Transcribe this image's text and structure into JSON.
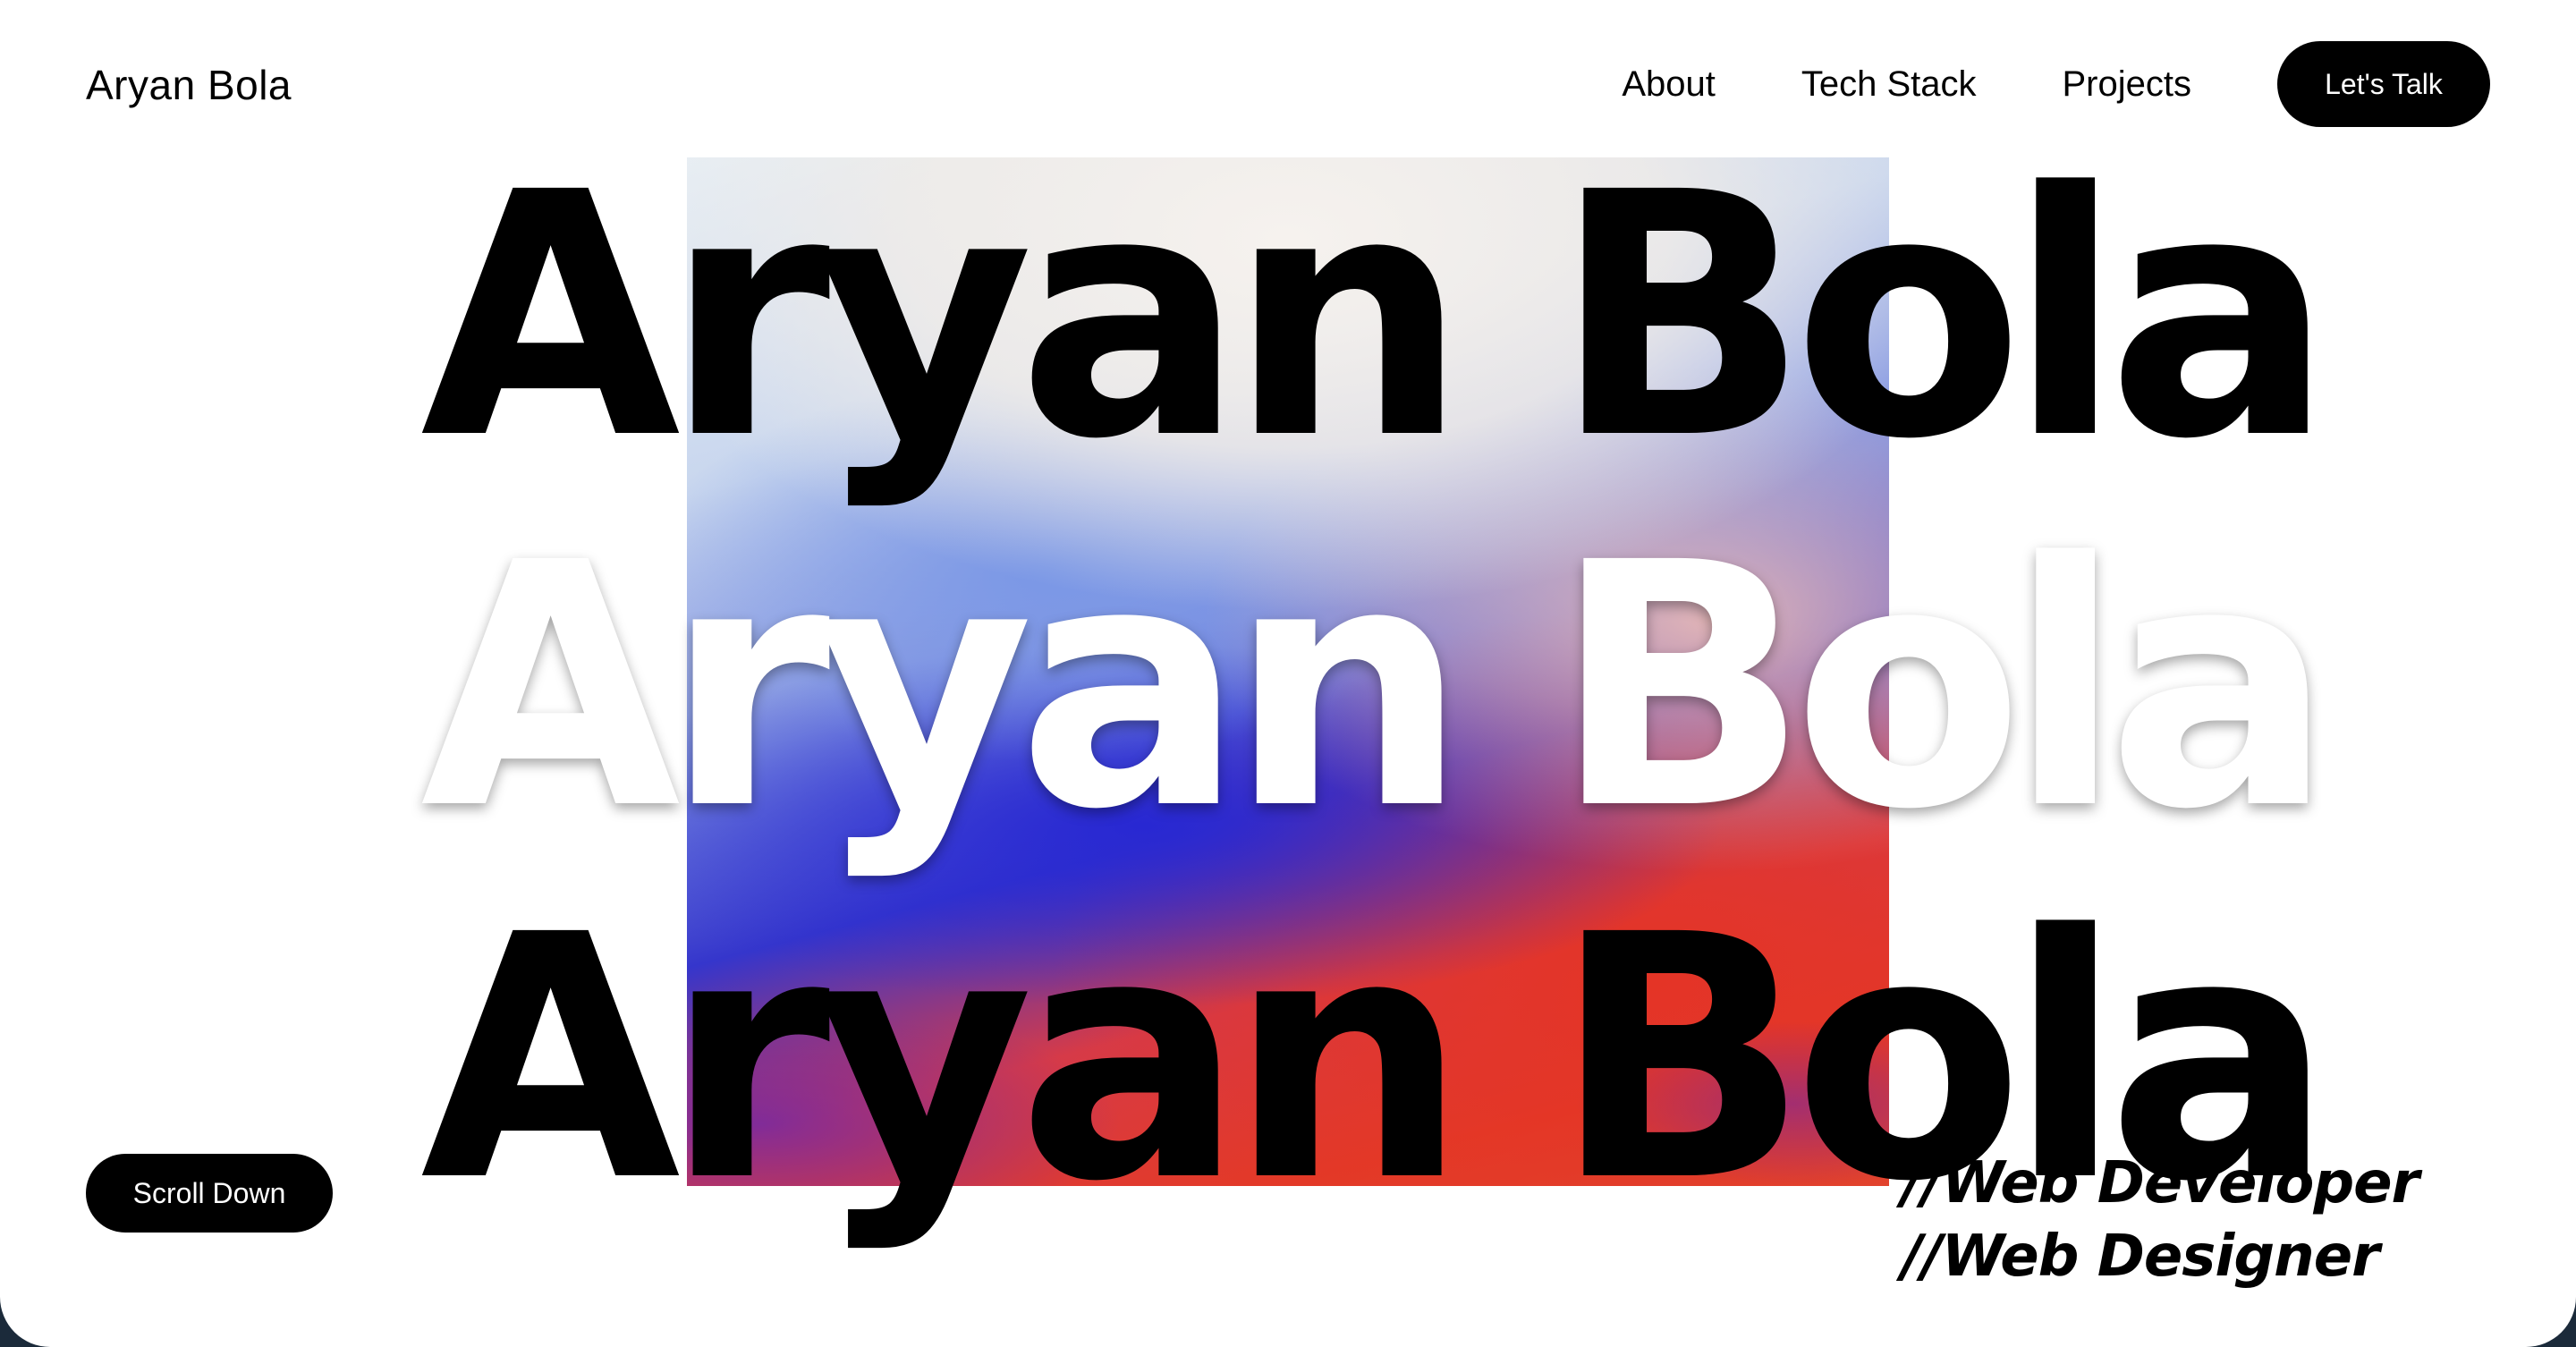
{
  "header": {
    "brand": "Aryan Bola",
    "nav": {
      "about": "About",
      "tech_stack": "Tech Stack",
      "projects": "Projects",
      "cta": "Let's Talk"
    }
  },
  "hero": {
    "lines": [
      "Aryan Bola",
      "Aryan Bola",
      "Aryan Bola"
    ],
    "roles": [
      "//Web Developer",
      "//Web Designer"
    ],
    "scroll_label": "Scroll Down"
  },
  "colors": {
    "background": "#ffffff",
    "text": "#000000",
    "button_bg": "#000000",
    "button_text": "#ffffff",
    "gradient_blue": "#3536cc",
    "gradient_red": "#e33a27"
  }
}
